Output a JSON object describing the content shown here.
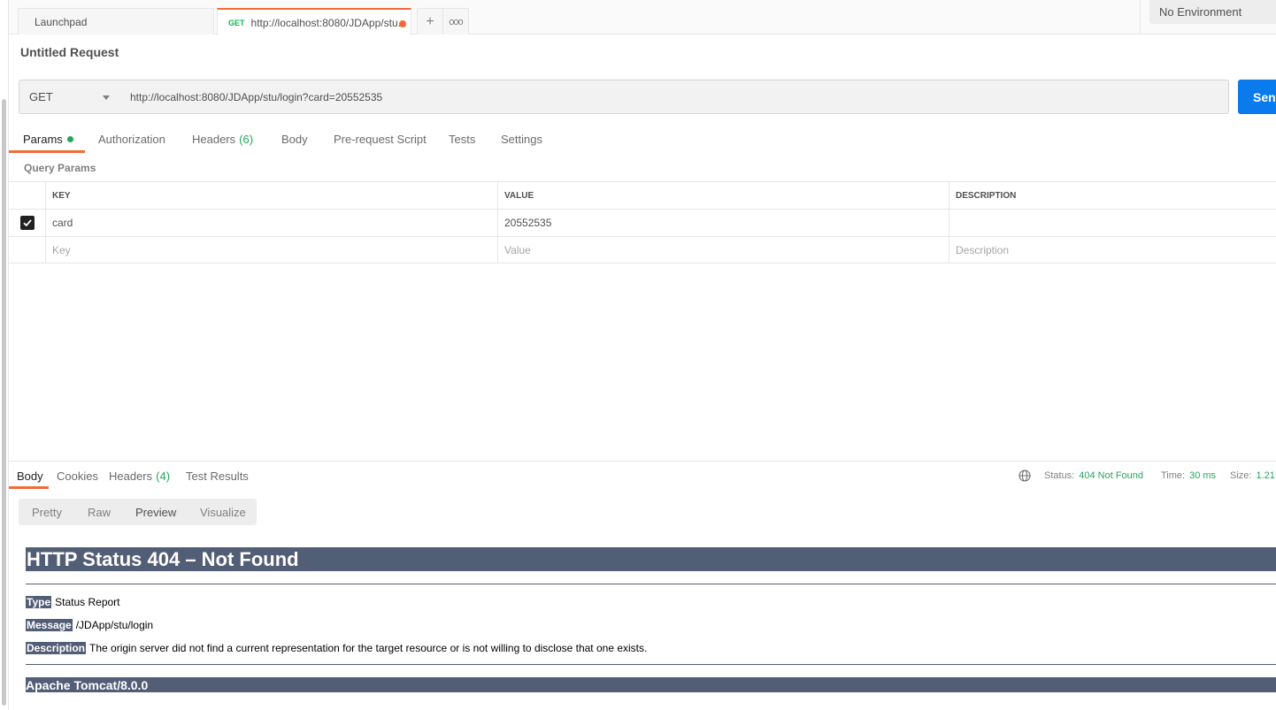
{
  "tabs": {
    "launchpad": "Launchpad",
    "active_method": "GET",
    "active_url": "http://localhost:8080/JDApp/stu...",
    "plus": "+",
    "more": "ooo"
  },
  "environment": "No Environment",
  "request": {
    "title": "Untitled Request",
    "method": "GET",
    "url": "http://localhost:8080/JDApp/stu/login?card=20552535",
    "send": "Send"
  },
  "request_tabs": {
    "params": "Params",
    "authorization": "Authorization",
    "headers": "Headers",
    "headers_count": "(6)",
    "body": "Body",
    "prerequest": "Pre-request Script",
    "tests": "Tests",
    "settings": "Settings"
  },
  "query_params": {
    "label": "Query Params",
    "columns": {
      "key": "KEY",
      "value": "VALUE",
      "description": "DESCRIPTION"
    },
    "rows": [
      {
        "checked": true,
        "key": "card",
        "value": "20552535",
        "description": ""
      }
    ],
    "placeholders": {
      "key": "Key",
      "value": "Value",
      "description": "Description"
    }
  },
  "response": {
    "tabs": {
      "body": "Body",
      "cookies": "Cookies",
      "headers": "Headers",
      "headers_count": "(4)",
      "test_results": "Test Results"
    },
    "status_label": "Status:",
    "status_value": "404 Not Found",
    "time_label": "Time:",
    "time_value": "30 ms",
    "size_label": "Size:",
    "size_value": "1.21",
    "views": {
      "pretty": "Pretty",
      "raw": "Raw",
      "preview": "Preview",
      "visualize": "Visualize"
    },
    "preview": {
      "heading": "HTTP Status 404 – Not Found",
      "type_label": "Type",
      "type_value": "Status Report",
      "message_label": "Message",
      "message_value": "/JDApp/stu/login",
      "description_label": "Description",
      "description_value": "The origin server did not find a current representation for the target resource or is not willing to disclose that one exists.",
      "footer": "Apache Tomcat/8.0.0"
    }
  },
  "colors": {
    "accent": "#f26b3a",
    "send": "#097bed",
    "success": "#26a65b",
    "tomcat": "#525d76"
  }
}
